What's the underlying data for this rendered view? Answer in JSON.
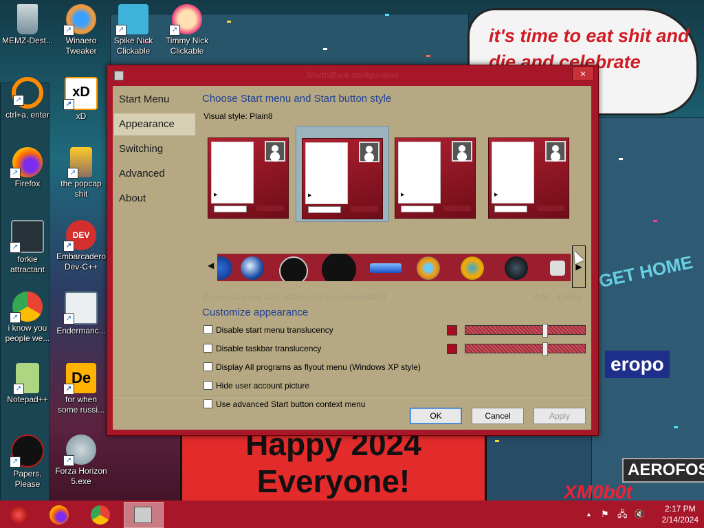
{
  "wallpaper": {
    "speech_text": "it's time to eat shit and die and celebrate",
    "banner_line1": "Happy 2024",
    "banner_line2": "Everyone!",
    "sign_gethome": "GET HOME",
    "sign_aero1": "eropo",
    "sign_aero2": "AEROFOS",
    "watermark": "XM0b0t"
  },
  "desktop_icons": [
    {
      "label": "MEMZ-Dest...",
      "icon": "recycle-bin-icon"
    },
    {
      "label": "Winaero Tweaker",
      "icon": "winaero-icon"
    },
    {
      "label": "Spike Nick Clickable",
      "icon": "spike-icon"
    },
    {
      "label": "Timmy Nick Clickable",
      "icon": "timmy-icon"
    },
    {
      "label": "ctrl+a, enter",
      "icon": "ring-icon"
    },
    {
      "label": "xD",
      "icon": "xd-icon"
    },
    {
      "label": "Firefox",
      "icon": "firefox-icon"
    },
    {
      "label": "the popcap shit",
      "icon": "popcap-icon"
    },
    {
      "label": "forkie attractant",
      "icon": "settings-monitor-icon"
    },
    {
      "label": "Embarcadero Dev-C++",
      "icon": "devcpp-icon"
    },
    {
      "label": "i know you people we...",
      "icon": "chrome-icon"
    },
    {
      "label": "Endermanc...",
      "icon": "window-app-icon"
    },
    {
      "label": "Notepad++",
      "icon": "notepadpp-icon"
    },
    {
      "label": "for when some russi...",
      "icon": "de-icon"
    },
    {
      "label": "Papers, Please",
      "icon": "papers-please-icon"
    },
    {
      "label": "Forza Horizon 5.exe",
      "icon": "flash-icon"
    }
  ],
  "dialog": {
    "title": "StartIsBack configuration",
    "close": "×",
    "nav": [
      "Start Menu",
      "Appearance",
      "Switching",
      "Advanced",
      "About"
    ],
    "selected_nav": "Appearance",
    "heading1": "Choose Start menu and Start button style",
    "visual_style_label": "Visual style:  Plain8",
    "download_link": "Download more start button orbs from deviantART",
    "add_delete": "Add...   Delete",
    "heading2": "Customize appearance",
    "options": [
      {
        "label": "Disable start menu translucency",
        "checked": false,
        "slider": 0.65
      },
      {
        "label": "Disable taskbar translucency",
        "checked": false,
        "slider": 0.65
      },
      {
        "label": "Display All programs as flyout menu (Windows XP style)",
        "checked": false
      },
      {
        "label": "Hide user account picture",
        "checked": false
      },
      {
        "label": "Use advanced Start button context menu",
        "checked": false
      }
    ],
    "buttons": {
      "ok": "OK",
      "cancel": "Cancel",
      "apply": "Apply"
    }
  },
  "taskbar": {
    "clock_time": "2:17 PM",
    "clock_date": "2/14/2024",
    "tray_up": "▲"
  }
}
